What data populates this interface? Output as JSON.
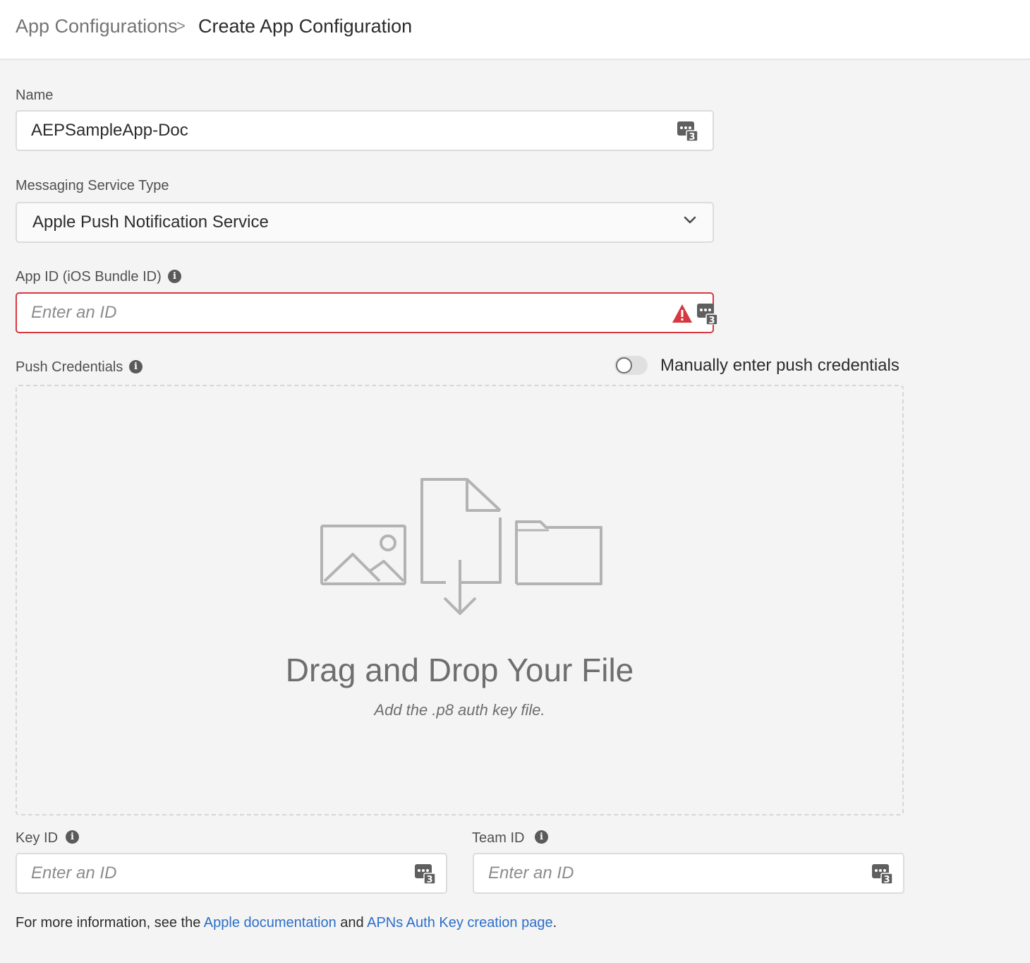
{
  "breadcrumb": {
    "parent": "App Configurations",
    "separator": ">",
    "current": "Create App Configuration"
  },
  "form": {
    "name": {
      "label": "Name",
      "value": "AEPSampleApp-Doc",
      "badge": "3"
    },
    "messaging_service_type": {
      "label": "Messaging Service Type",
      "selected": "Apple Push Notification Service"
    },
    "app_id": {
      "label": "App ID (iOS Bundle ID)",
      "placeholder": "Enter an ID",
      "badge": "3",
      "state": "error"
    },
    "push_credentials": {
      "label": "Push Credentials",
      "toggle_label": "Manually enter push credentials",
      "toggle_on": false,
      "dropzone_title": "Drag and Drop Your File",
      "dropzone_subtitle": "Add the .p8 auth key file."
    },
    "key_id": {
      "label": "Key ID",
      "placeholder": "Enter an ID",
      "badge": "3"
    },
    "team_id": {
      "label": "Team ID",
      "placeholder": "Enter an ID",
      "badge": "3"
    }
  },
  "footer": {
    "prefix": "For more information, see the ",
    "link1": "Apple documentation",
    "middle": " and ",
    "link2": "APNs Auth Key creation page",
    "suffix": "."
  },
  "colors": {
    "error": "#d7373f",
    "link": "#2d6ec9",
    "background": "#f4f4f4"
  }
}
